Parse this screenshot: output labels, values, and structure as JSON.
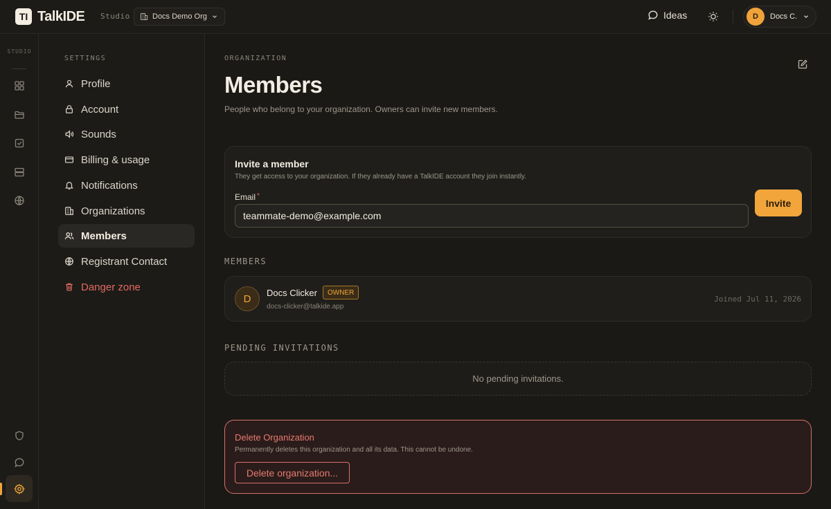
{
  "header": {
    "logo_mark": "TI",
    "app_name": "TalkIDE",
    "workspace_label": "Studio",
    "org_name": "Docs Demo Org",
    "ideas_label": "Ideas",
    "user_initial": "D",
    "user_name": "Docs C."
  },
  "rail": {
    "label": "STUDIO",
    "icons": [
      "grid-icon",
      "folder-icon",
      "checkbox-icon",
      "server-icon",
      "globe-icon",
      "shield-icon",
      "chat-icon",
      "gear-icon"
    ],
    "active": "gear-icon"
  },
  "settings_nav": {
    "heading": "SETTINGS",
    "items": [
      {
        "label": "Profile",
        "icon": "user-icon"
      },
      {
        "label": "Account",
        "icon": "lock-icon"
      },
      {
        "label": "Sounds",
        "icon": "speaker-icon"
      },
      {
        "label": "Billing & usage",
        "icon": "card-icon"
      },
      {
        "label": "Notifications",
        "icon": "bell-icon"
      },
      {
        "label": "Organizations",
        "icon": "building-icon"
      },
      {
        "label": "Members",
        "icon": "users-icon",
        "active": true
      },
      {
        "label": "Registrant Contact",
        "icon": "globe-icon"
      },
      {
        "label": "Danger zone",
        "icon": "trash-icon",
        "danger": true
      }
    ]
  },
  "main": {
    "eyebrow": "ORGANIZATION",
    "title": "Members",
    "description": "People who belong to your organization. Owners can invite new members.",
    "invite": {
      "title": "Invite a member",
      "subtitle": "They get access to your organization. If they already have a TalkIDE account they join instantly.",
      "email_label": "Email",
      "required_mark": "*",
      "email_value": "teammate-demo@example.com",
      "button_label": "Invite"
    },
    "members_heading": "MEMBERS",
    "members": [
      {
        "initial": "D",
        "name": "Docs Clicker",
        "role": "OWNER",
        "email": "docs-clicker@talkide.app",
        "joined": "Joined Jul 11, 2026"
      }
    ],
    "pending_heading": "PENDING INVITATIONS",
    "pending_empty": "No pending invitations.",
    "danger": {
      "title": "Delete Organization",
      "subtitle": "Permanently deletes this organization and all its data. This cannot be undone.",
      "button_label": "Delete organization..."
    }
  },
  "colors": {
    "background": "#1a1916",
    "accent": "#f2a53b",
    "danger": "#e36a60",
    "text": "#f3ede2"
  }
}
